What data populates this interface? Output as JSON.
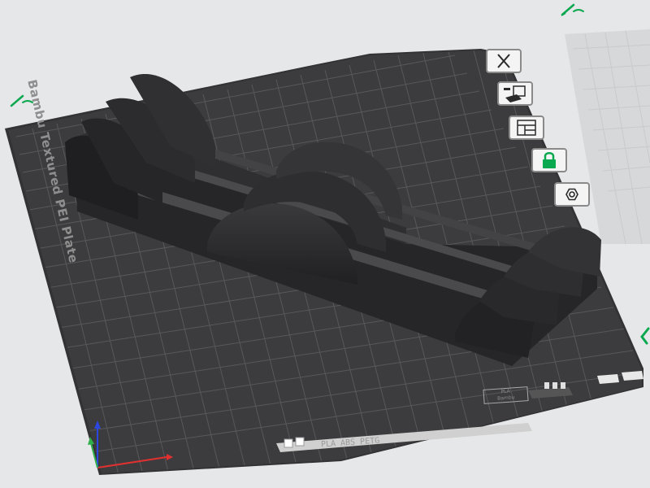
{
  "plate": {
    "label": "Bambu Textured PEI Plate",
    "filament_types": "PLA ABS PETG",
    "label_box_line1": "PLA",
    "label_box_line2": "Bambu"
  },
  "toolbar": {
    "buttons": [
      {
        "name": "delete-plate-button",
        "icon": "x-icon"
      },
      {
        "name": "auto-arrange-button",
        "icon": "arrange-icon"
      },
      {
        "name": "layout-button",
        "icon": "layout-icon"
      },
      {
        "name": "lock-plate-button",
        "icon": "lock-icon"
      },
      {
        "name": "plate-settings-button",
        "icon": "gear-nut-icon"
      }
    ]
  },
  "colors": {
    "background": "#e6e7e8",
    "plate": "#3c3c3e",
    "grid": "#575759",
    "model": "#2b2b2d",
    "accent_green": "#0aa84f",
    "axis_x": "#e03030",
    "axis_y": "#2fb04a",
    "axis_z": "#2b47e0"
  }
}
